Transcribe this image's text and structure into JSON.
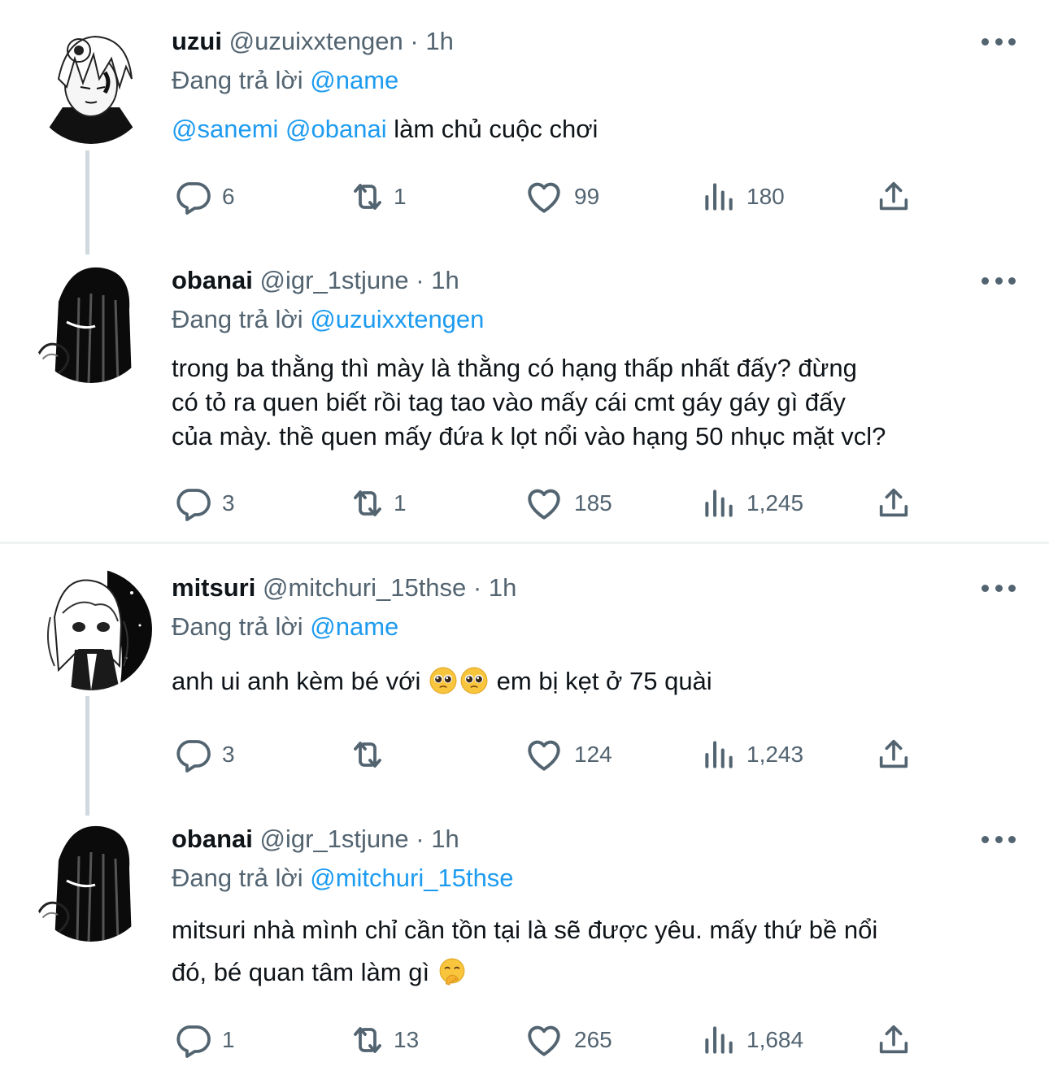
{
  "replying_label": "Đang trả lời",
  "tweets": [
    {
      "name": "uzui",
      "handle": "@uzuixxtengen",
      "time": "1h",
      "reply_to": "@name",
      "mentions": [
        "@sanemi",
        "@obanai"
      ],
      "text": "làm chủ cuộc chơi",
      "replies": "6",
      "retweets": "1",
      "likes": "99",
      "views": "180"
    },
    {
      "name": "obanai",
      "handle": "@igr_1stjune",
      "time": "1h",
      "reply_to": "@uzuixxtengen",
      "text_lines": [
        "trong ba thằng thì mày là thằng có hạng thấp nhất đấy? đừng",
        "có tỏ ra quen biết rồi tag tao vào mấy cái cmt gáy gáy gì đấy",
        "của mày. thề quen mấy đứa k lọt nổi vào hạng 50 nhục mặt vcl?"
      ],
      "replies": "3",
      "retweets": "1",
      "likes": "185",
      "views": "1,245"
    },
    {
      "name": "mitsuri",
      "handle": "@mitchuri_15thse",
      "time": "1h",
      "reply_to": "@name",
      "text_before": "anh ui anh kèm bé với",
      "text_after": "em bị kẹt ở 75 quài",
      "emoji": [
        "pleading-face",
        "pleading-face"
      ],
      "replies": "3",
      "retweets": "",
      "likes": "124",
      "views": "1,243"
    },
    {
      "name": "obanai",
      "handle": "@igr_1stjune",
      "time": "1h",
      "reply_to": "@mitchuri_15thse",
      "text_lines": [
        "mitsuri nhà mình chỉ cần tồn tại là sẽ được yêu. mấy thứ bề nổi",
        "đó, bé quan tâm làm gì"
      ],
      "emoji": [
        "face-with-hand-over-mouth"
      ],
      "replies": "1",
      "retweets": "13",
      "likes": "265",
      "views": "1,684"
    }
  ],
  "colors": {
    "text": "#0f1419",
    "secondary": "#536471",
    "accent": "#1d9bf0",
    "thread_line": "#cfd9de",
    "divider": "#eff3f4"
  },
  "icons": [
    "reply-icon",
    "retweet-icon",
    "like-icon",
    "views-icon",
    "share-icon",
    "more-icon"
  ]
}
